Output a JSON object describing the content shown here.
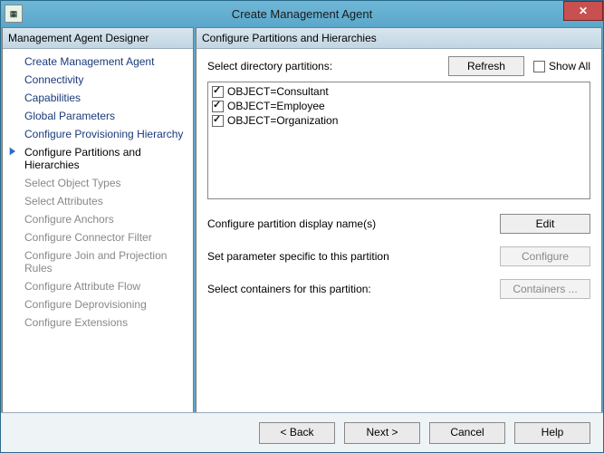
{
  "window": {
    "title": "Create Management Agent"
  },
  "sidebar": {
    "header": "Management Agent Designer",
    "items": [
      {
        "label": "Create Management Agent",
        "state": "completed"
      },
      {
        "label": "Connectivity",
        "state": "completed"
      },
      {
        "label": "Capabilities",
        "state": "completed"
      },
      {
        "label": "Global Parameters",
        "state": "completed"
      },
      {
        "label": "Configure Provisioning Hierarchy",
        "state": "completed"
      },
      {
        "label": "Configure Partitions and Hierarchies",
        "state": "current"
      },
      {
        "label": "Select Object Types",
        "state": "pending"
      },
      {
        "label": "Select Attributes",
        "state": "pending"
      },
      {
        "label": "Configure Anchors",
        "state": "pending"
      },
      {
        "label": "Configure Connector Filter",
        "state": "pending"
      },
      {
        "label": "Configure Join and Projection Rules",
        "state": "pending"
      },
      {
        "label": "Configure Attribute Flow",
        "state": "pending"
      },
      {
        "label": "Configure Deprovisioning",
        "state": "pending"
      },
      {
        "label": "Configure Extensions",
        "state": "pending"
      }
    ]
  },
  "main": {
    "header": "Configure Partitions and Hierarchies",
    "select_label": "Select directory partitions:",
    "refresh": "Refresh",
    "showall": {
      "label": "Show All",
      "checked": false
    },
    "partitions": [
      {
        "label": "OBJECT=Consultant",
        "checked": true
      },
      {
        "label": "OBJECT=Employee",
        "checked": true
      },
      {
        "label": "OBJECT=Organization",
        "checked": true
      }
    ],
    "rows": [
      {
        "lbl": "Configure partition display name(s)",
        "btn": "Edit",
        "enabled": true
      },
      {
        "lbl": "Set parameter specific to this partition",
        "btn": "Configure",
        "enabled": false
      },
      {
        "lbl": "Select containers for this partition:",
        "btn": "Containers ...",
        "enabled": false
      }
    ]
  },
  "footer": {
    "back": "<  Back",
    "next": "Next  >",
    "cancel": "Cancel",
    "help": "Help"
  }
}
